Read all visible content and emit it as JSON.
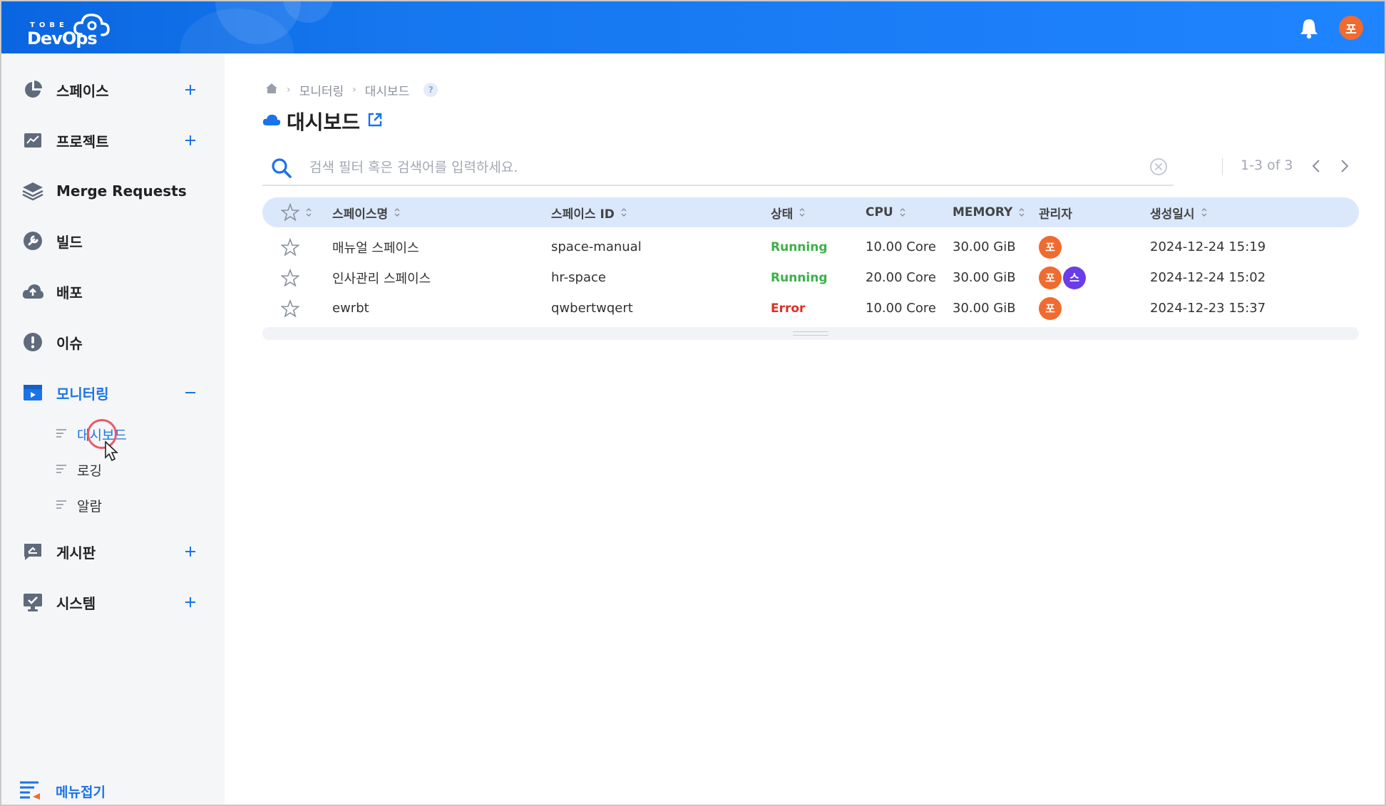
{
  "app": {
    "logo_small": "TOBE",
    "logo_big": "DevOps",
    "user_initial": "포",
    "brand_color": "#1677ef"
  },
  "sidebar": {
    "items": [
      {
        "label": "스페이스",
        "icon": "pie-chart-icon",
        "expandable": "plus"
      },
      {
        "label": "프로젝트",
        "icon": "project-board-icon",
        "expandable": "plus"
      },
      {
        "label": "Merge Requests",
        "icon": "layers-icon",
        "expandable": ""
      },
      {
        "label": "빌드",
        "icon": "wrench-icon",
        "expandable": ""
      },
      {
        "label": "배포",
        "icon": "cloud-upload-icon",
        "expandable": ""
      },
      {
        "label": "이슈",
        "icon": "alert-icon",
        "expandable": ""
      },
      {
        "label": "모니터링",
        "icon": "monitor-window-icon",
        "expandable": "minus",
        "active": true
      },
      {
        "label": "게시판",
        "icon": "board-icon",
        "expandable": "plus"
      },
      {
        "label": "시스템",
        "icon": "system-monitor-icon",
        "expandable": "plus"
      }
    ],
    "sub_items": [
      {
        "label": "대시보드",
        "active": true
      },
      {
        "label": "로깅"
      },
      {
        "label": "알람"
      }
    ],
    "collapse_label": "메뉴접기"
  },
  "breadcrumb": {
    "items": [
      "모니터링",
      "대시보드"
    ],
    "help": "?"
  },
  "page_title": "대시보드",
  "search": {
    "placeholder": "검색 필터 혹은 검색어를 입력하세요.",
    "value": ""
  },
  "pager": {
    "text": "1-3 of 3"
  },
  "table": {
    "columns": [
      "스페이스명",
      "스페이스 ID",
      "상태",
      "CPU",
      "MEMORY",
      "관리자",
      "생성일시"
    ],
    "rows": [
      {
        "name": "매뉴얼 스페이스",
        "id": "space-manual",
        "status": "Running",
        "cpu": "10.00 Core",
        "memory": "30.00 GiB",
        "managers": [
          "포"
        ],
        "created": "2024-12-24 15:19"
      },
      {
        "name": "인사관리 스페이스",
        "id": "hr-space",
        "status": "Running",
        "cpu": "20.00 Core",
        "memory": "30.00 GiB",
        "managers": [
          "포",
          "스"
        ],
        "created": "2024-12-24 15:02"
      },
      {
        "name": "ewrbt",
        "id": "qwbertwqert",
        "status": "Error",
        "cpu": "10.00 Core",
        "memory": "30.00 GiB",
        "managers": [
          "포"
        ],
        "created": "2024-12-23 15:37"
      }
    ]
  },
  "colors": {
    "running": "#3cb14a",
    "error": "#d93025",
    "avatar_primary": "#f06b2f",
    "avatar_secondary": "#6a3de8"
  }
}
